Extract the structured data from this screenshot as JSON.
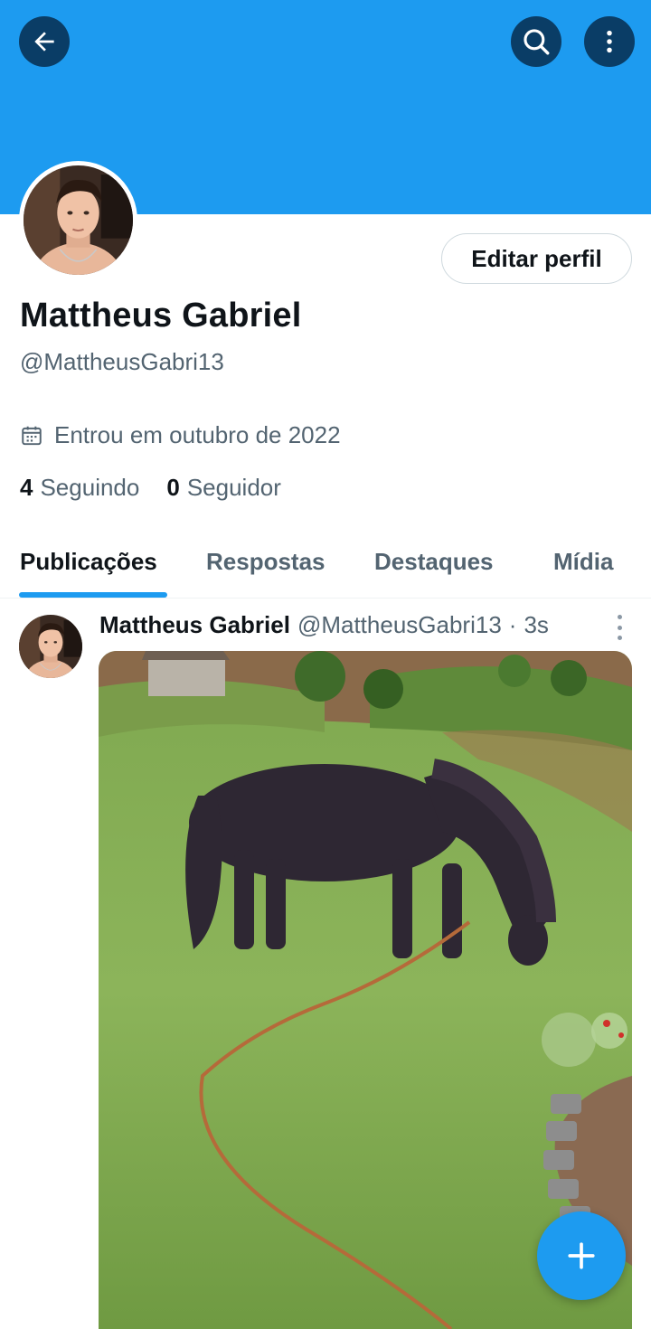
{
  "header": {
    "back_icon": "arrow-left-icon",
    "search_icon": "search-icon",
    "more_icon": "more-vertical-icon",
    "banner_color": "#1d9bf0"
  },
  "profile": {
    "display_name": "Mattheus Gabriel",
    "handle": "@MattheusGabri13",
    "joined": "Entrou em outubro de 2022",
    "edit_label": "Editar perfil",
    "following_count": "4",
    "following_label": "Seguindo",
    "followers_count": "0",
    "followers_label": "Seguidor"
  },
  "tabs": [
    {
      "label": "Publicações",
      "active": true
    },
    {
      "label": "Respostas",
      "active": false
    },
    {
      "label": "Destaques",
      "active": false
    },
    {
      "label": "Mídia",
      "active": false
    }
  ],
  "post": {
    "author_name": "Mattheus Gabriel",
    "author_handle": "@MattheusGabri13",
    "separator": "·",
    "time": "3s"
  },
  "fab": {
    "icon": "plus-icon",
    "color": "#1d9bf0"
  }
}
